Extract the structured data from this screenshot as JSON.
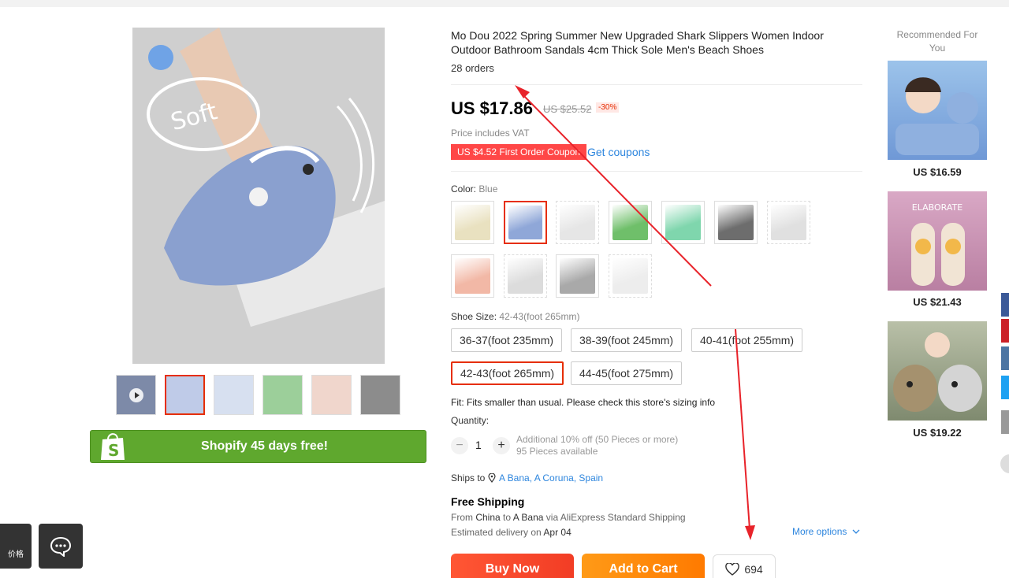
{
  "product": {
    "title": "Mo Dou 2022 Spring Summer New Upgraded Shark Slippers Women Indoor Outdoor Bathroom Sandals 4cm Thick Sole Men's Beach Shoes",
    "orders": "28 orders",
    "image_overlay_text": "Soft"
  },
  "price": {
    "current": "US $17.86",
    "original": "US $25.52",
    "discount": "-30%",
    "vat_note": "Price includes VAT",
    "coupon": "US $4.52 First Order Coupon",
    "get_coupons": "Get coupons"
  },
  "gallery": {
    "banner_text": "Shopify 45 days free!",
    "thumbs": [
      "video",
      "blue",
      "blue-side",
      "green",
      "pink",
      "grey"
    ]
  },
  "color": {
    "label": "Color:",
    "selected": "Blue",
    "swatches": [
      {
        "name": "beige",
        "color": "#e9e1c0"
      },
      {
        "name": "blue",
        "color": "#8fa7d8"
      },
      {
        "name": "white",
        "color": "#e6e6e6"
      },
      {
        "name": "green",
        "color": "#6fbf6a"
      },
      {
        "name": "mint",
        "color": "#7fd6ad"
      },
      {
        "name": "black",
        "color": "#6d6d6d"
      },
      {
        "name": "light-grey",
        "color": "#e0e0e0"
      },
      {
        "name": "pink",
        "color": "#f2b8a6"
      },
      {
        "name": "silver",
        "color": "#dcdcdc"
      },
      {
        "name": "dark-grey",
        "color": "#a9a9a9"
      },
      {
        "name": "off-white",
        "color": "#ededed"
      }
    ]
  },
  "size": {
    "label": "Shoe Size:",
    "selected": "42-43(foot 265mm)",
    "options": [
      "36-37(foot 235mm)",
      "38-39(foot 245mm)",
      "40-41(foot 255mm)",
      "42-43(foot 265mm)",
      "44-45(foot 275mm)"
    ]
  },
  "fit_note": "Fit: Fits smaller than usual. Please check this store's sizing info",
  "quantity": {
    "label": "Quantity:",
    "value": "1",
    "minus": "−",
    "plus": "+",
    "note1": "Additional 10% off (50 Pieces or more)",
    "note2": "95 Pieces available"
  },
  "shipping": {
    "ships_to_label": "Ships to",
    "location": "A Bana, A Coruna, Spain",
    "free": "Free Shipping",
    "route_from": "From",
    "route_country": "China",
    "route_to": "to",
    "route_city": "A Bana",
    "route_via": "via AliExpress Standard Shipping",
    "estimated_label": "Estimated delivery on",
    "estimated_date": "Apr 04",
    "more_options": "More options"
  },
  "actions": {
    "buy_now": "Buy Now",
    "add_to_cart": "Add to Cart",
    "wishlist_count": "694"
  },
  "recommended": {
    "title": "Recommended For You",
    "items": [
      {
        "price": "US $16.59",
        "color": "#8ab4e6"
      },
      {
        "price": "US $21.43",
        "color": "#c98fb2"
      },
      {
        "price": "US $19.22",
        "color": "#9aa38f"
      }
    ],
    "item2_caption": "ELABORATE"
  },
  "floating": {
    "left_label": "价格"
  },
  "colors": {
    "accent_red": "#e62e04",
    "link_blue": "#2e86de",
    "buy_now": "#f23d25",
    "add_cart": "#ff7a00",
    "shopify_green": "#5fa82e"
  }
}
